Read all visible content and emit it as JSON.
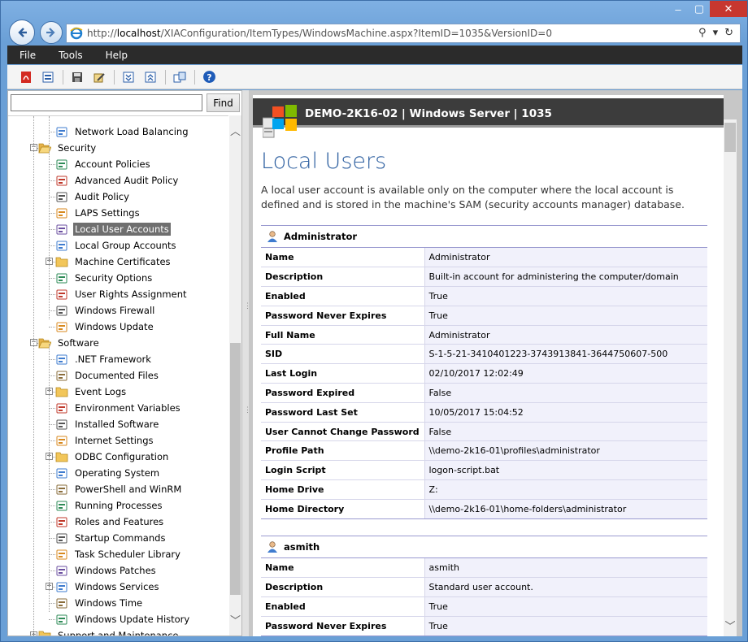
{
  "browser": {
    "url_prefix": "http://",
    "url_host": "localhost",
    "url_path": "/XIAConfiguration/ItemTypes/WindowsMachine.aspx?ItemID=1035&VersionID=0"
  },
  "menu": [
    "File",
    "Tools",
    "Help"
  ],
  "toolbar_icons": [
    "pdf-export-icon",
    "print-preview-icon",
    "save-icon",
    "edit-icon",
    "expand-all-icon",
    "collapse-all-icon",
    "compare-icon",
    "help-icon"
  ],
  "search": {
    "value": "",
    "find_label": "Find"
  },
  "tree": [
    {
      "label": "Network Load Balancing",
      "icon": "network-load-balancing-icon",
      "level": 2
    },
    {
      "label": "Security",
      "icon": "folder-open-icon",
      "level": 1,
      "expander": "−"
    },
    {
      "label": "Account Policies",
      "icon": "account-policies-icon",
      "level": 2
    },
    {
      "label": "Advanced Audit Policy",
      "icon": "advanced-audit-policy-icon",
      "level": 2
    },
    {
      "label": "Audit Policy",
      "icon": "audit-policy-icon",
      "level": 2
    },
    {
      "label": "LAPS Settings",
      "icon": "laps-icon",
      "level": 2
    },
    {
      "label": "Local User Accounts",
      "icon": "local-users-icon",
      "level": 2,
      "selected": true
    },
    {
      "label": "Local Group Accounts",
      "icon": "local-groups-icon",
      "level": 2
    },
    {
      "label": "Machine Certificates",
      "icon": "folder-icon",
      "level": 2,
      "expander": "+"
    },
    {
      "label": "Security Options",
      "icon": "security-options-icon",
      "level": 2
    },
    {
      "label": "User Rights Assignment",
      "icon": "user-rights-icon",
      "level": 2
    },
    {
      "label": "Windows Firewall",
      "icon": "firewall-icon",
      "level": 2
    },
    {
      "label": "Windows Update",
      "icon": "windows-update-icon",
      "level": 2
    },
    {
      "label": "Software",
      "icon": "folder-open-icon",
      "level": 1,
      "expander": "−"
    },
    {
      "label": ".NET Framework",
      "icon": "dotnet-icon",
      "level": 2
    },
    {
      "label": "Documented Files",
      "icon": "documented-files-icon",
      "level": 2
    },
    {
      "label": "Event Logs",
      "icon": "folder-icon",
      "level": 2,
      "expander": "+"
    },
    {
      "label": "Environment Variables",
      "icon": "environment-variables-icon",
      "level": 2
    },
    {
      "label": "Installed Software",
      "icon": "installed-software-icon",
      "level": 2
    },
    {
      "label": "Internet Settings",
      "icon": "internet-settings-icon",
      "level": 2
    },
    {
      "label": "ODBC Configuration",
      "icon": "folder-icon",
      "level": 2,
      "expander": "+"
    },
    {
      "label": "Operating System",
      "icon": "operating-system-icon",
      "level": 2
    },
    {
      "label": "PowerShell and WinRM",
      "icon": "powershell-icon",
      "level": 2
    },
    {
      "label": "Running Processes",
      "icon": "running-processes-icon",
      "level": 2
    },
    {
      "label": "Roles and Features",
      "icon": "roles-features-icon",
      "level": 2
    },
    {
      "label": "Startup Commands",
      "icon": "startup-commands-icon",
      "level": 2
    },
    {
      "label": "Task Scheduler Library",
      "icon": "task-scheduler-icon",
      "level": 2
    },
    {
      "label": "Windows Patches",
      "icon": "windows-patches-icon",
      "level": 2
    },
    {
      "label": "Windows Services",
      "icon": "windows-services-icon",
      "level": 2,
      "expander": "+"
    },
    {
      "label": "Windows Time",
      "icon": "windows-time-icon",
      "level": 2
    },
    {
      "label": "Windows Update History",
      "icon": "windows-update-history-icon",
      "level": 2
    },
    {
      "label": "Support and Maintenance",
      "icon": "folder-icon",
      "level": 1,
      "expander": "+"
    }
  ],
  "header": {
    "title": "DEMO-2K16-02 | Windows Server | 1035"
  },
  "page": {
    "title": "Local Users",
    "description": "A local user account is available only on the computer where the local account is defined and is stored in the machine's SAM (security accounts manager) database."
  },
  "users": [
    {
      "name": "Administrator",
      "props": [
        {
          "k": "Name",
          "v": "Administrator"
        },
        {
          "k": "Description",
          "v": "Built-in account for administering the computer/domain"
        },
        {
          "k": "Enabled",
          "v": "True"
        },
        {
          "k": "Password Never Expires",
          "v": "True"
        },
        {
          "k": "Full Name",
          "v": "Administrator"
        },
        {
          "k": "SID",
          "v": "S-1-5-21-3410401223-3743913841-3644750607-500"
        },
        {
          "k": "Last Login",
          "v": "02/10/2017 12:02:49"
        },
        {
          "k": "Password Expired",
          "v": "False"
        },
        {
          "k": "Password Last Set",
          "v": "10/05/2017 15:04:52"
        },
        {
          "k": "User Cannot Change Password",
          "v": "False"
        },
        {
          "k": "Profile Path",
          "v": "\\\\demo-2k16-01\\profiles\\administrator"
        },
        {
          "k": "Login Script",
          "v": "logon-script.bat"
        },
        {
          "k": "Home Drive",
          "v": "Z:"
        },
        {
          "k": "Home Directory",
          "v": "\\\\demo-2k16-01\\home-folders\\administrator"
        }
      ]
    },
    {
      "name": "asmith",
      "props": [
        {
          "k": "Name",
          "v": "asmith"
        },
        {
          "k": "Description",
          "v": "Standard user account."
        },
        {
          "k": "Enabled",
          "v": "True"
        },
        {
          "k": "Password Never Expires",
          "v": "True"
        }
      ]
    }
  ],
  "colors": {
    "menubar": "#2b2b2b",
    "header_bar": "#3c3c3c",
    "page_title": "#2d5fa0",
    "selected_tree_item": "#6f6f6f",
    "table_value_bg": "#f1f1fb",
    "close_button": "#c7372f"
  }
}
